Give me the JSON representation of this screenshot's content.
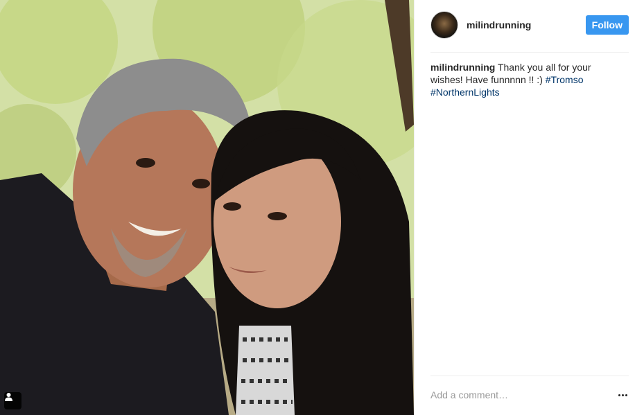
{
  "post": {
    "photo": {
      "alt_icon": "person-tag-icon"
    },
    "author": {
      "username": "milindrunning",
      "avatar_icon": "avatar"
    },
    "follow_label": "Follow",
    "caption": {
      "username": "milindrunning",
      "text": " Thank you all for your wishes! Have funnnnn !! :) ",
      "hashtags": [
        "#Tromso",
        "#NorthernLights"
      ]
    },
    "comment": {
      "placeholder": "Add a comment…"
    },
    "more_icon": "more-options-icon"
  },
  "colors": {
    "follow_button": "#3897f0",
    "hashtag": "#003569",
    "text": "#262626",
    "placeholder": "#999999"
  }
}
